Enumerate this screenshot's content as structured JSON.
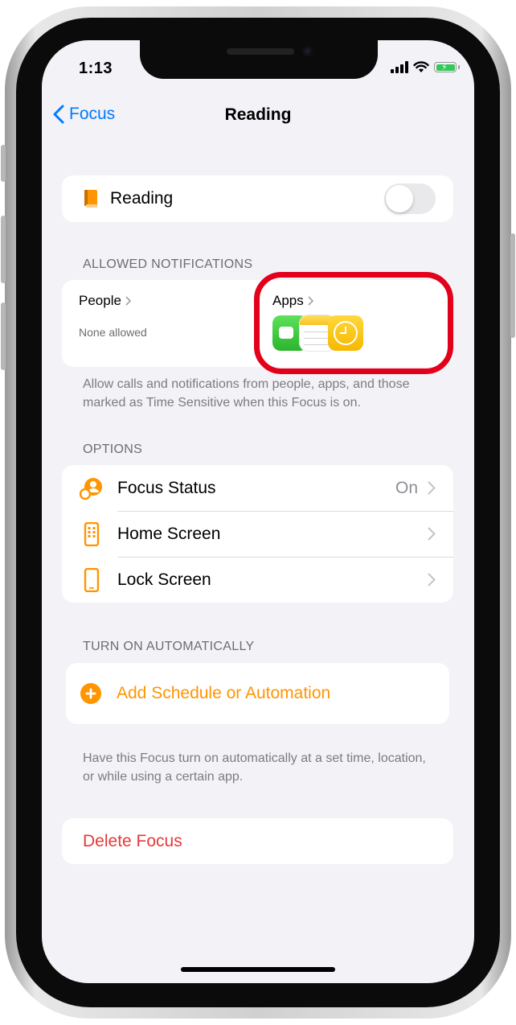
{
  "status_bar": {
    "time": "1:13"
  },
  "nav": {
    "back_label": "Focus",
    "title": "Reading"
  },
  "focus_row": {
    "label": "Reading",
    "toggle_on": false,
    "icon": "book-icon"
  },
  "allowed_notifications": {
    "header": "ALLOWED NOTIFICATIONS",
    "people": {
      "label": "People",
      "subtitle": "None allowed"
    },
    "apps": {
      "label": "Apps",
      "icons": [
        "facetime-icon",
        "notes-icon",
        "clock-icon"
      ]
    },
    "footer": "Allow calls and notifications from people, apps, and those marked as Time Sensitive when this Focus is on."
  },
  "options": {
    "header": "OPTIONS",
    "items": [
      {
        "label": "Focus Status",
        "value": "On",
        "icon": "focus-status-icon"
      },
      {
        "label": "Home Screen",
        "value": "",
        "icon": "home-screen-icon"
      },
      {
        "label": "Lock Screen",
        "value": "",
        "icon": "lock-screen-icon"
      }
    ]
  },
  "automation": {
    "header": "TURN ON AUTOMATICALLY",
    "add_label": "Add Schedule or Automation",
    "footer": "Have this Focus turn on automatically at a set time, location, or while using a certain app."
  },
  "delete": {
    "label": "Delete Focus"
  },
  "colors": {
    "accent": "#007aff",
    "orange": "#ff9500",
    "destructive": "#ff3b30",
    "highlight": "#e3001b",
    "background": "#f2f2f7"
  }
}
